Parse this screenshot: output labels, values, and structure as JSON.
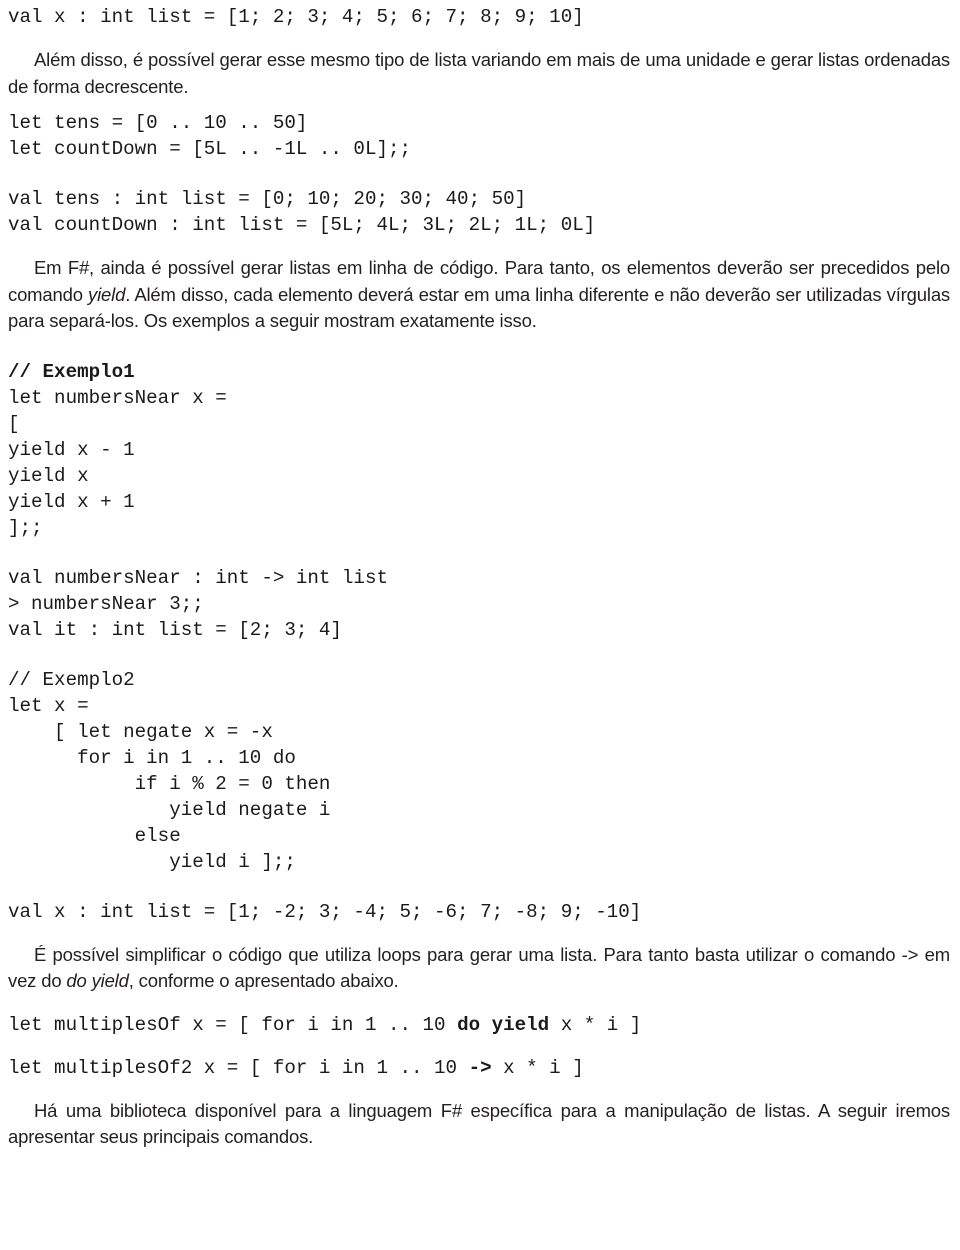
{
  "document": {
    "language": "pt-BR",
    "topic": "Geração de listas em F#",
    "text_color": "#231f20",
    "background_color": "#ffffff"
  },
  "blocks": {
    "code_val_x_range": "val x : int list = [1; 2; 3; 4; 5; 6; 7; 8; 9; 10]",
    "para_alem_disso": "Além disso, é possível gerar esse mesmo tipo de lista variando em mais de uma unidade e gerar listas ordenadas de forma decrescente.",
    "code_tens_let_1": "let tens = [0 .. 10 .. 50]",
    "code_tens_let_2": "let countDown = [5L .. -1L .. 0L];;",
    "code_tens_val_1": "val tens : int list = [0; 10; 20; 30; 40; 50]",
    "code_tens_val_2": "val countDown : int list = [5L; 4L; 3L; 2L; 1L; 0L]",
    "para_em_fsharp_1": "Em F#, ainda é possível gerar listas em linha de código. Para tanto, os elementos deverão ser precedidos pelo comando ",
    "para_em_fsharp_italic": "yield",
    "para_em_fsharp_2": ". Além disso, cada elemento deverá estar em uma linha diferente e não deverão ser utilizadas vírgulas para separá-los. Os exemplos a seguir mostram exatamente isso.",
    "exemplo1": {
      "comment": "// Exemplo1",
      "lines": [
        "let numbersNear x =",
        "[",
        "yield x - 1",
        "yield x",
        "yield x + 1",
        "];;"
      ],
      "output": [
        "val numbersNear : int -> int list",
        "> numbersNear 3;;",
        "val it : int list = [2; 3; 4]"
      ]
    },
    "exemplo2": {
      "comment": "// Exemplo2",
      "lines": [
        "let x =",
        "    [ let negate x = -x",
        "      for i in 1 .. 10 do",
        "           if i % 2 = 0 then",
        "              yield negate i",
        "           else",
        "              yield i ];;"
      ],
      "output": "val x : int list = [1; -2; 3; -4; 5; -6; 7; -8; 9; -10]"
    },
    "para_simplificar_1": "É possível simplificar o código que utiliza loops para gerar uma lista. Para tanto basta utilizar o comando -> em vez do ",
    "para_simplificar_italic": "do yield",
    "para_simplificar_2": ", conforme o apresentado abaixo.",
    "code_multiples_1_a": "let multiplesOf x = [ for i in 1 .. 10 ",
    "code_multiples_1_bold": "do yield",
    "code_multiples_1_b": " x * i ]",
    "code_multiples_2_a": "let multiplesOf2 x = [ for i in 1 .. 10 ",
    "code_multiples_2_bold": "->",
    "code_multiples_2_b": " x * i ]",
    "para_biblioteca": "Há uma biblioteca disponível para a linguagem F# específica para a manipulação de listas. A seguir iremos apresentar seus principais comandos."
  }
}
